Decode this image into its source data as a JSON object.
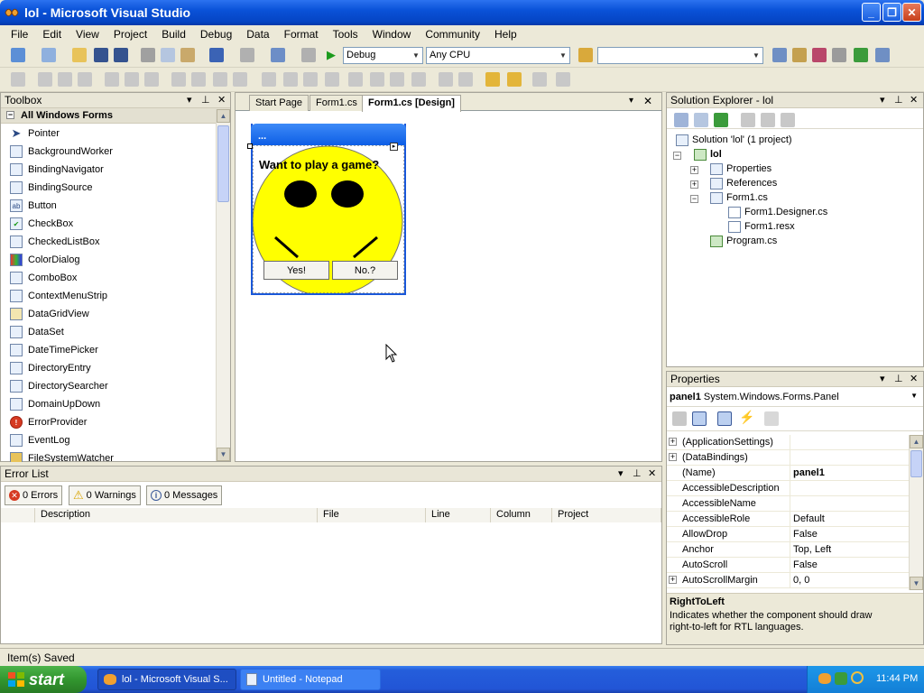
{
  "window": {
    "title": "lol - Microsoft Visual Studio"
  },
  "menu": [
    "File",
    "Edit",
    "View",
    "Project",
    "Build",
    "Debug",
    "Data",
    "Format",
    "Tools",
    "Window",
    "Community",
    "Help"
  ],
  "toolbar": {
    "config": "Debug",
    "platform": "Any CPU",
    "search": ""
  },
  "toolbox": {
    "title": "Toolbox",
    "group": "All Windows Forms",
    "items": [
      "Pointer",
      "BackgroundWorker",
      "BindingNavigator",
      "BindingSource",
      "Button",
      "CheckBox",
      "CheckedListBox",
      "ColorDialog",
      "ComboBox",
      "ContextMenuStrip",
      "DataGridView",
      "DataSet",
      "DateTimePicker",
      "DirectoryEntry",
      "DirectorySearcher",
      "DomainUpDown",
      "ErrorProvider",
      "EventLog",
      "FileSystemWatcher"
    ]
  },
  "tabs": [
    "Start Page",
    "Form1.cs",
    "Form1.cs [Design]"
  ],
  "form": {
    "title": "...",
    "question": "Want to play a game?",
    "yes": "Yes!",
    "no": "No.?",
    "face_color": "#ffff00"
  },
  "errorlist": {
    "title": "Error List",
    "errors": "0 Errors",
    "warnings": "0 Warnings",
    "messages": "0 Messages",
    "columns": [
      "Description",
      "File",
      "Line",
      "Column",
      "Project"
    ]
  },
  "solution": {
    "title": "Solution Explorer - lol",
    "nodes": [
      "Solution 'lol' (1 project)",
      "lol",
      "Properties",
      "References",
      "Form1.cs",
      "Form1.Designer.cs",
      "Form1.resx",
      "Program.cs"
    ]
  },
  "properties": {
    "title": "Properties",
    "object": "panel1",
    "type": "System.Windows.Forms.Panel",
    "rows": [
      {
        "name": "(ApplicationSettings)",
        "value": ""
      },
      {
        "name": "(DataBindings)",
        "value": ""
      },
      {
        "name": "(Name)",
        "value": "panel1"
      },
      {
        "name": "AccessibleDescription",
        "value": ""
      },
      {
        "name": "AccessibleName",
        "value": ""
      },
      {
        "name": "AccessibleRole",
        "value": "Default"
      },
      {
        "name": "AllowDrop",
        "value": "False"
      },
      {
        "name": "Anchor",
        "value": "Top, Left"
      },
      {
        "name": "AutoScroll",
        "value": "False"
      },
      {
        "name": "AutoScrollMargin",
        "value": "0, 0"
      }
    ],
    "desc_title": "RightToLeft",
    "desc_text": "Indicates whether the component should draw right-to-left for RTL languages."
  },
  "status": "Item(s) Saved",
  "taskbar": {
    "start": "start",
    "tasks": [
      "lol - Microsoft Visual S...",
      "Untitled - Notepad"
    ],
    "clock": "11:44 PM"
  }
}
